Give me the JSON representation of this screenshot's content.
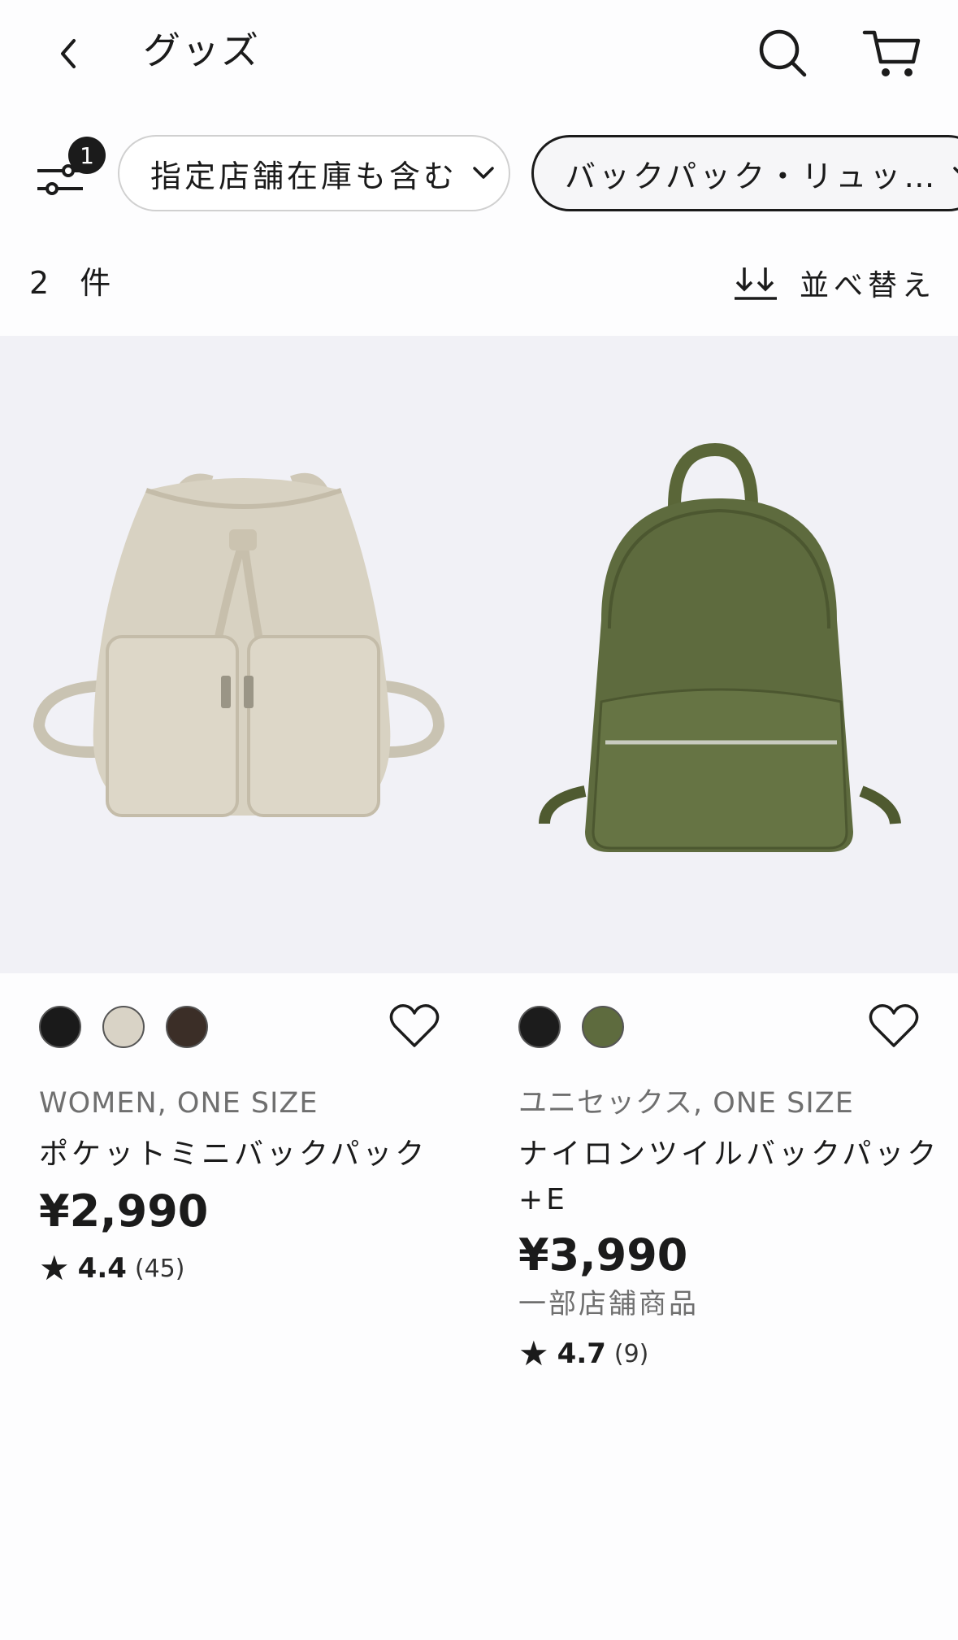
{
  "header": {
    "title": "グッズ",
    "back_icon": "chevron-left-icon",
    "search_icon": "search-icon",
    "cart_icon": "cart-icon"
  },
  "filters": {
    "badge_count": "1",
    "store_chip": "指定店舗在庫も含む",
    "category_chip": "バックパック・リュッ…"
  },
  "results": {
    "count": "2",
    "unit": "件",
    "sort_label": "並べ替え"
  },
  "products": [
    {
      "swatches": [
        "#1a1a1a",
        "#d9d3c6",
        "#3b2e27"
      ],
      "meta": "WOMEN, ONE SIZE",
      "name": "ポケットミニバックパック",
      "price": "¥2,990",
      "rating": "4.4",
      "reviews": "(45)",
      "image": "beige drawstring backpack"
    },
    {
      "swatches": [
        "#1c1c1c",
        "#5e6b3e"
      ],
      "meta": "ユニセックス, ONE SIZE",
      "name_line1": "ナイロンツイルバックパック",
      "name_line2": "+E",
      "price": "¥3,990",
      "availability": "一部店舗商品",
      "rating": "4.7",
      "reviews": "(9)",
      "image": "olive nylon backpack"
    }
  ]
}
